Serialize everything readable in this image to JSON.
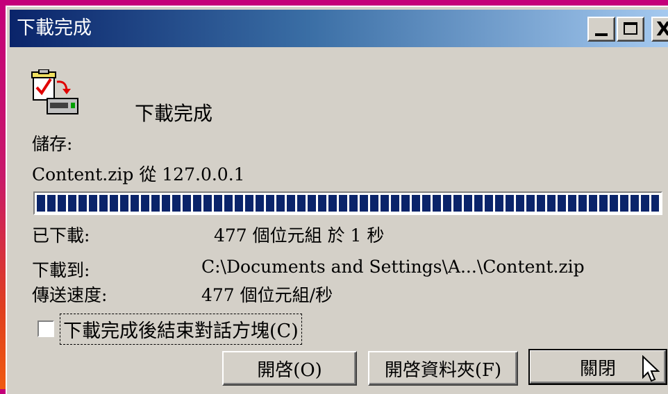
{
  "window": {
    "title": "下載完成",
    "controls": {
      "minimize": "_",
      "maximize": "□",
      "close": "X"
    }
  },
  "header": {
    "icon": "download-complete-icon",
    "heading": "下載完成"
  },
  "info": {
    "save_label": "儲存:",
    "source_text": "Content.zip 從 127.0.0.1",
    "downloaded_label": "已下載:",
    "downloaded_value": "477 個位元組 於 1 秒",
    "destination_label": "下載到:",
    "destination_value": "C:\\Documents and Settings\\A...\\Content.zip",
    "speed_label": "傳送速度:",
    "speed_value": "477 個位元組/秒"
  },
  "progress": {
    "percent": 100,
    "color": "#0a246a"
  },
  "checkbox": {
    "label": "下載完成後結束對話方塊(C)",
    "checked": false
  },
  "buttons": {
    "open": "開啓(O)",
    "open_folder": "開啓資料夾(F)",
    "close": "關閉"
  },
  "colors": {
    "titlebar_start": "#0a246a",
    "titlebar_end": "#a6caf0",
    "face": "#d4d0c8"
  }
}
